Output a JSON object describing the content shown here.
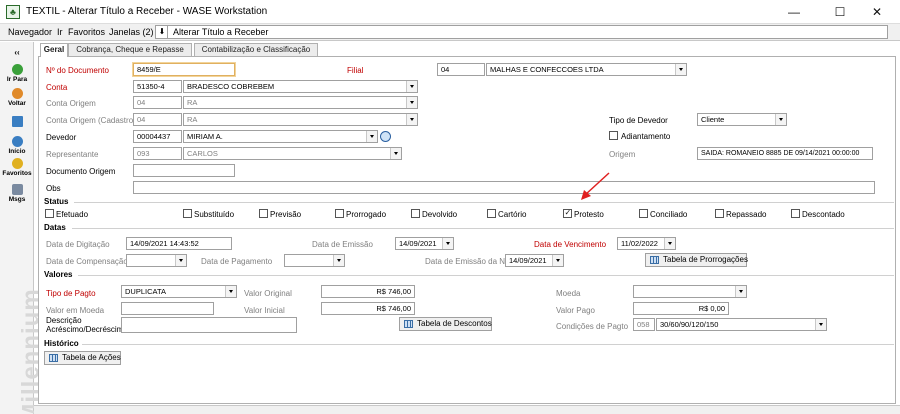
{
  "window": {
    "title": "TEXTIL - Alterar Título a Receber - WASE Workstation",
    "minimize": "—",
    "maximize": "☐",
    "close": "✕"
  },
  "menu": {
    "items": [
      "Navegador",
      "Ir",
      "Favoritos",
      "Janelas (2)"
    ],
    "breadcrumb_arrow": "⬇",
    "breadcrumb": "Alterar Título a Receber"
  },
  "sidebar": {
    "collapse": "‹‹",
    "items": [
      {
        "label": "Ir Para",
        "icon": "go-to-icon",
        "color": "#3aa03a"
      },
      {
        "label": "Voltar",
        "icon": "back-icon",
        "color": "#e08a2a"
      },
      {
        "label": "",
        "icon": "document-icon",
        "color": "#3a7ec2"
      },
      {
        "label": "Início",
        "icon": "home-icon",
        "color": "#3a7ec2"
      },
      {
        "label": "Favoritos",
        "icon": "favorites-icon",
        "color": "#e0b020"
      },
      {
        "label": "Msgs",
        "icon": "messages-icon",
        "color": "#7a8aa0"
      }
    ],
    "brand": "Millennium"
  },
  "tabs": [
    "Geral",
    "Cobrança, Cheque e Repasse",
    "Contabilização e Classificação"
  ],
  "form": {
    "num_documento": {
      "label": "Nº do Documento",
      "value": "8459/E"
    },
    "filial": {
      "label": "Filial",
      "code": "04",
      "name": "MALHAS E CONFECCOES LTDA"
    },
    "conta": {
      "label": "Conta",
      "code": "51350-4",
      "name": "BRADESCO COBREBEM"
    },
    "conta_origem": {
      "label": "Conta Origem",
      "code": "04",
      "name": "RA"
    },
    "conta_origem_cad": {
      "label": "Conta Origem (Cadastro)",
      "code": "04",
      "name": "RA"
    },
    "tipo_devedor": {
      "label": "Tipo de Devedor",
      "value": "Cliente"
    },
    "devedor": {
      "label": "Devedor",
      "code": "00004437",
      "name": "MIRIAM A."
    },
    "adiantamento": {
      "label": "Adiantamento"
    },
    "representante": {
      "label": "Representante",
      "code": "093",
      "name": "CARLOS"
    },
    "origem": {
      "label": "Origem",
      "value": "SAIDA:  ROMANEIO 8885 DE 09/14/2021 00:00:00"
    },
    "documento_origem": {
      "label": "Documento Origem",
      "value": ""
    },
    "obs": {
      "label": "Obs",
      "value": ""
    }
  },
  "status": {
    "title": "Status",
    "items": [
      {
        "label": "Efetuado",
        "checked": false
      },
      {
        "label": "Substituído",
        "checked": false
      },
      {
        "label": "Previsão",
        "checked": false
      },
      {
        "label": "Prorrogado",
        "checked": false
      },
      {
        "label": "Devolvido",
        "checked": false
      },
      {
        "label": "Cartório",
        "checked": false
      },
      {
        "label": "Protesto",
        "checked": true
      },
      {
        "label": "Conciliado",
        "checked": false
      },
      {
        "label": "Repassado",
        "checked": false
      },
      {
        "label": "Descontado",
        "checked": false
      }
    ]
  },
  "datas": {
    "title": "Datas",
    "digitacao": {
      "label": "Data de Digitação",
      "value": "14/09/2021 14:43:52"
    },
    "emissao": {
      "label": "Data de Emissão",
      "value": "14/09/2021"
    },
    "vencimento": {
      "label": "Data de Vencimento",
      "value": "11/02/2022"
    },
    "compensacao": {
      "label": "Data de Compensação",
      "value": ""
    },
    "pagamento": {
      "label": "Data de Pagamento",
      "value": ""
    },
    "emissao_nf": {
      "label": "Data de Emissão da NF",
      "value": "14/09/2021"
    },
    "prorrogacoes_button": "Tabela de Prorrogações"
  },
  "valores": {
    "title": "Valores",
    "tipo_pagto": {
      "label": "Tipo de Pagto",
      "value": "DUPLICATA"
    },
    "valor_original": {
      "label": "Valor Original",
      "value": "R$ 746,00"
    },
    "moeda": {
      "label": "Moeda",
      "value": ""
    },
    "valor_moeda": {
      "label": "Valor em Moeda",
      "value": ""
    },
    "valor_inicial": {
      "label": "Valor Inicial",
      "value": "R$ 746,00"
    },
    "valor_pago": {
      "label": "Valor Pago",
      "value": "R$ 0,00"
    },
    "descricao_line1": "Descrição",
    "descricao_line2": "Acréscimo/Decréscimo",
    "descricao_value": "",
    "descontos_button": "Tabela de Descontos",
    "condicoes": {
      "label": "Condições de Pagto",
      "code": "058",
      "value": "30/60/90/120/150"
    }
  },
  "historico": {
    "title": "Histórico",
    "acoes_button": "Tabela de Ações"
  },
  "colors": {
    "required_label": "#c00000",
    "annotation_arrow": "#e02020"
  }
}
